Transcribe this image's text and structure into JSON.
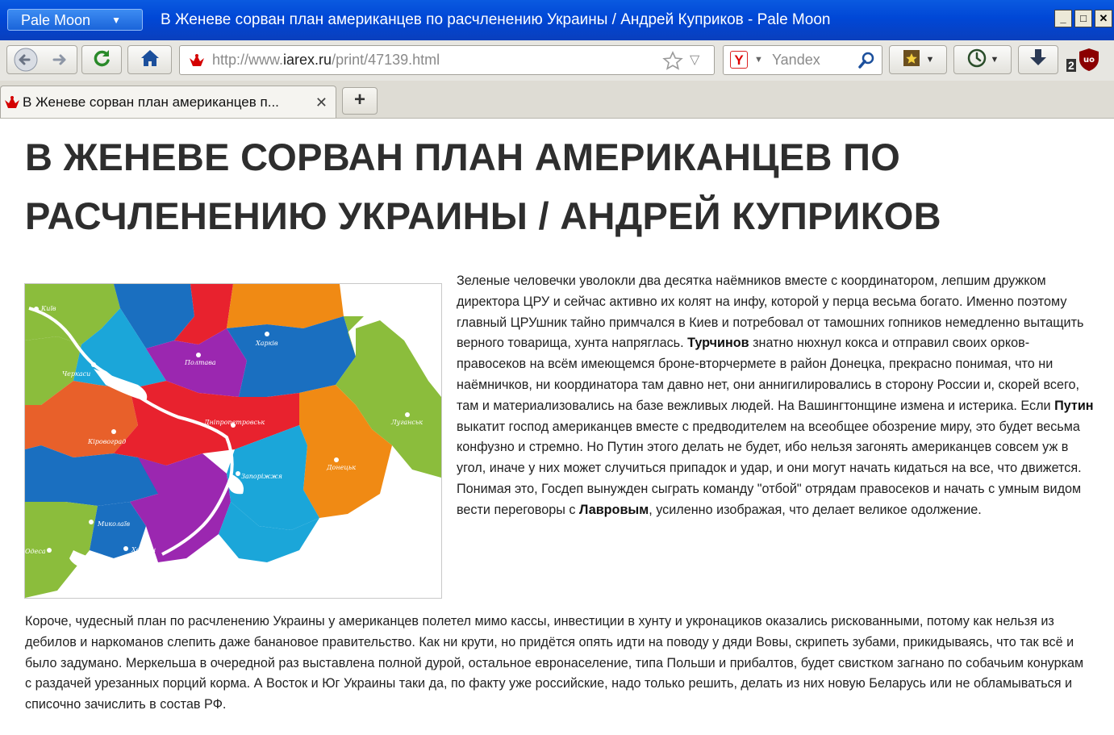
{
  "window": {
    "app_menu_label": "Pale Moon",
    "title": "В Женеве сорван план американцев по расчленению Украины / Андрей Куприков - Pale Moon"
  },
  "toolbar": {
    "url_prefix": "http://www.",
    "url_host": "iarex.ru",
    "url_path": "/print/47139.html",
    "search_engine": "Yandex",
    "addon_badge": "2"
  },
  "tabs": [
    {
      "title": "В Женеве сорван план американцев п...",
      "close": "✕"
    }
  ],
  "new_tab": "+",
  "article": {
    "headline": "В ЖЕНЕВЕ СОРВАН ПЛАН АМЕРИКАНЦЕВ ПО РАСЧЛЕНЕНИЮ УКРАИНЫ / АНДРЕЙ КУПРИКОВ",
    "p1_a": "Зеленые человечки уволокли два десятка наёмников вместе с координатором, лепшим дружком директора ЦРУ и сейчас активно их колят на инфу, которой у перца весьма богато. Именно поэтому главный ЦРУшник тайно примчался в Киев и потребовал от тамошних гопников немедленно вытащить верного товарища, хунта напряглась. ",
    "p1_b1": "Турчинов",
    "p1_c": " знатно нюхнул кокса и отправил своих орков-правосеков на всём имеющемся броне-вторчермете в район Донецка, прекрасно понимая, что ни наёмничков, ни координатора там давно нет, они аннигилировались в сторону России и, скорей всего, там и материализовались на базе вежливых людей. На Вашингтонщине измена и истерика. Если ",
    "p1_b2": "Путин",
    "p1_d": " выкатит господ американцев вместе с предводителем на всеобщее обозрение миру, это будет весьма конфузно и стремно. Но Путин этого делать не будет, ибо нельзя загонять американцев совсем уж в угол, иначе у них может случиться припадок и удар, и они могут начать кидаться на все, что движется. Понимая это, Госдеп вынужден сыграть команду \"отбой\" отрядам правосеков и начать с умным видом вести переговоры с ",
    "p1_b3": "Лавровым",
    "p1_e": ", усиленно изображая, что делает великое одолжение.",
    "p2": "Короче, чудесный план по расчленению Украины у американцев полетел мимо кассы, инвестиции в хунту и укронациков оказались рискованными, потому как нельзя из дебилов и наркоманов слепить даже банановое правительство. Как ни крути, но придётся опять идти на поводу у дяди Вовы, скрипеть зубами, прикидываясь, что так всё и было задумано. Меркельша в очередной раз выставлена полной дурой, остальное евронаселение, типа Польши и прибалтов, будет свистком загнано по собачьим конуркам с раздачей урезанных порций корма. А Восток и Юг Украины таки да, по факту уже российские, надо только решить, делать из них новую Беларусь или не обламываться и списочно зачислить в состав РФ."
  },
  "map": {
    "cities": [
      "Київ",
      "Черкаси",
      "Полтава",
      "Харків",
      "Дніпропетровськ",
      "Луганськ",
      "Кіровоград",
      "Запоріжжя",
      "Донецьк",
      "Миколаїв",
      "Херсон",
      "Одеса"
    ]
  }
}
